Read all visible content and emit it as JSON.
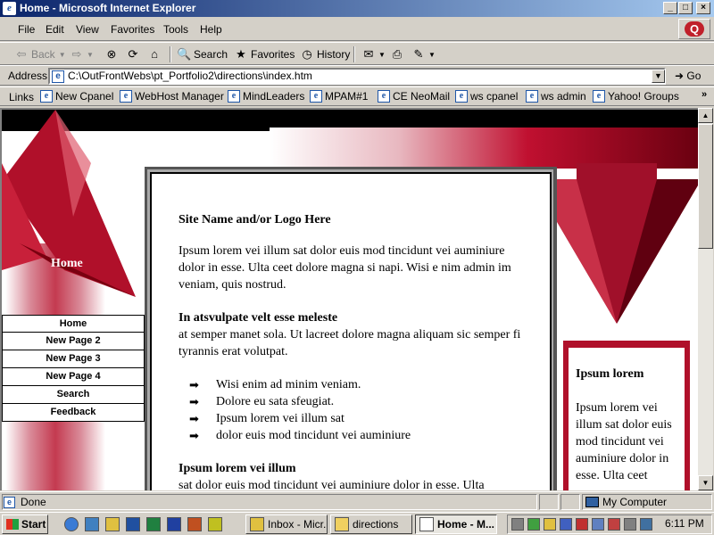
{
  "window": {
    "title": "Home - Microsoft Internet Explorer",
    "buttons": {
      "minimize": "_",
      "maximize": "□",
      "close": "×"
    }
  },
  "menu": [
    "File",
    "Edit",
    "View",
    "Favorites",
    "Tools",
    "Help"
  ],
  "toolbar": {
    "back": "Back",
    "search": "Search",
    "favorites": "Favorites",
    "history": "History"
  },
  "address": {
    "label": "Address",
    "url": "C:\\OutFrontWebs\\pt_Portfolio2\\directions\\index.htm",
    "go": "Go"
  },
  "links": {
    "label": "Links",
    "items": [
      "New Cpanel",
      "WebHost Manager",
      "MindLeaders",
      "MPAM#1",
      "CE NeoMail",
      "ws cpanel",
      "ws admin",
      "Yahoo! Groups"
    ],
    "more": "»"
  },
  "page": {
    "home_label": "Home",
    "nav": [
      "Home",
      "New Page 2",
      "New Page 3",
      "New Page 4",
      "Search",
      "Feedback"
    ],
    "main": {
      "site_name": "Site Name and/or Logo Here",
      "intro": "Ipsum lorem vei illum sat dolor euis mod tincidunt vei auminiure dolor in esse. Ulta ceet dolore magna si napi. Wisi e nim admin im veniam, quis nostrud.",
      "heading2": "In atsvulpate velt esse meleste",
      "para2": "at semper manet sola. Ut lacreet dolore magna aliquam sic semper fi tyrannis erat volutpat.",
      "bullets": [
        "Wisi enim ad minim veniam.",
        "Dolore eu sata sfeugiat.",
        "Ipsum lorem vei illum sat",
        "dolor euis mod tincidunt vei auminiure"
      ],
      "heading3": "Ipsum lorem vei illum",
      "para3": "sat dolor euis mod tincidunt vei auminiure dolor in esse. Ulta"
    },
    "sidebox": {
      "heading": "Ipsum lorem",
      "text": "Ipsum lorem vei illum sat dolor euis mod tincidunt vei auminiure dolor in esse. Ulta ceet"
    }
  },
  "status": {
    "text": "Done",
    "zone": "My Computer"
  },
  "taskbar": {
    "start": "Start",
    "tasks": [
      "Inbox - Micr...",
      "directions",
      "Home - M..."
    ],
    "clock": "6:11 PM"
  },
  "colors": {
    "accent_red": "#b0102a",
    "titlebar_start": "#0a246a",
    "titlebar_end": "#a6caf0"
  }
}
